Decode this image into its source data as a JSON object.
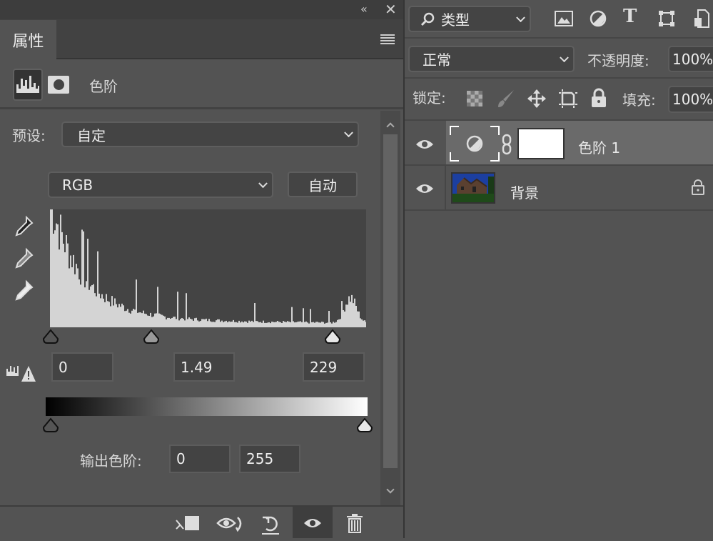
{
  "properties_panel": {
    "tab_label": "属性",
    "adjustment_title": "色阶",
    "preset_label": "预设:",
    "preset_value": "自定",
    "channel_value": "RGB",
    "auto_label": "自动",
    "input_levels": {
      "black": "0",
      "gamma": "1.49",
      "white": "229"
    },
    "output_label": "输出色阶:",
    "output_levels": {
      "black": "0",
      "white": "255"
    },
    "histogram_color": "#d4d4d4"
  },
  "layers_panel": {
    "filter_value": "类型",
    "blend_mode": "正常",
    "opacity_label": "不透明度:",
    "opacity_value": "100%",
    "lock_label": "锁定:",
    "fill_label": "填充:",
    "fill_value": "100%",
    "layers": [
      {
        "name": "色阶 1",
        "selected": true
      },
      {
        "name": "背景",
        "locked": true
      }
    ]
  }
}
